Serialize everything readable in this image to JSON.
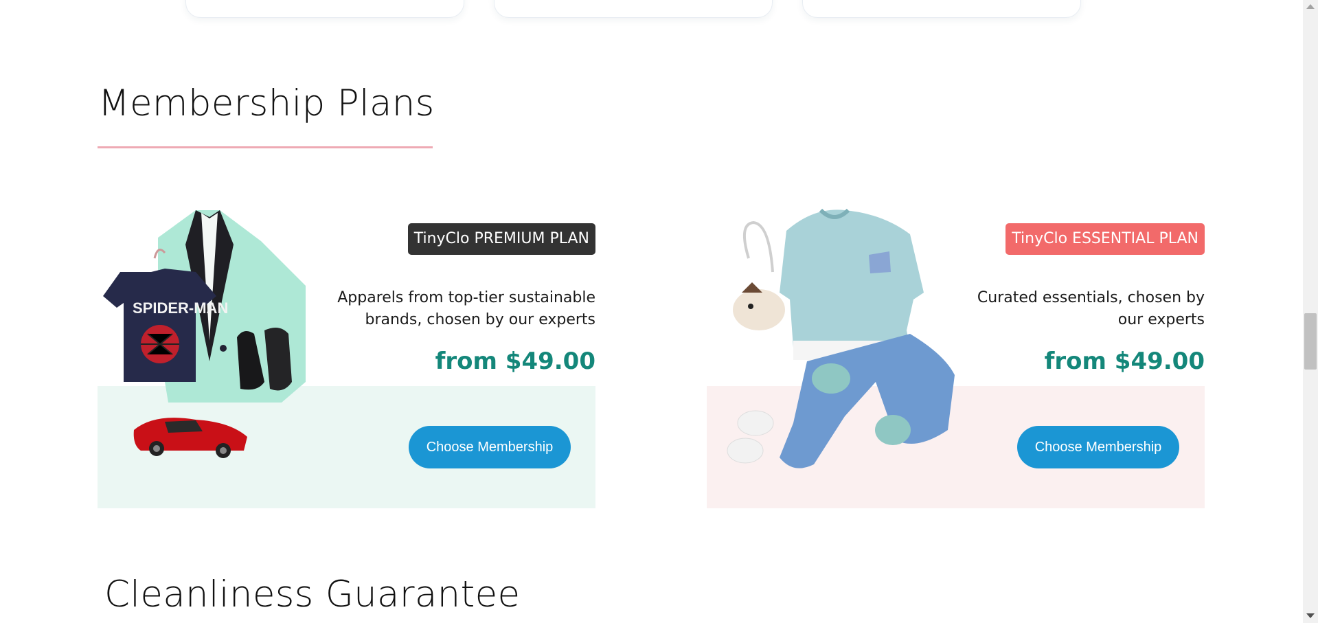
{
  "membership": {
    "title": "Membership Plans",
    "plans": [
      {
        "badge": "TinyClo PREMIUM PLAN",
        "description_line1": "Apparels from top-tier sustainable",
        "description_line2": "brands, chosen by our experts",
        "price": "from $49.00",
        "cta": "Choose Membership",
        "badge_color": "#333333",
        "panel_color": "#ebf7f3"
      },
      {
        "badge": "TinyClo ESSENTIAL PLAN",
        "description_line1": "Curated essentials, chosen by",
        "description_line2": "our experts",
        "price": "from $49.00",
        "cta": "Choose Membership",
        "badge_color": "#f26a6a",
        "panel_color": "#fbf0f0"
      }
    ]
  },
  "cleanliness": {
    "title": "Cleanliness Guarantee"
  },
  "colors": {
    "accent": "#1b96d4",
    "price": "#14877a",
    "underline": "#eeaab4"
  }
}
